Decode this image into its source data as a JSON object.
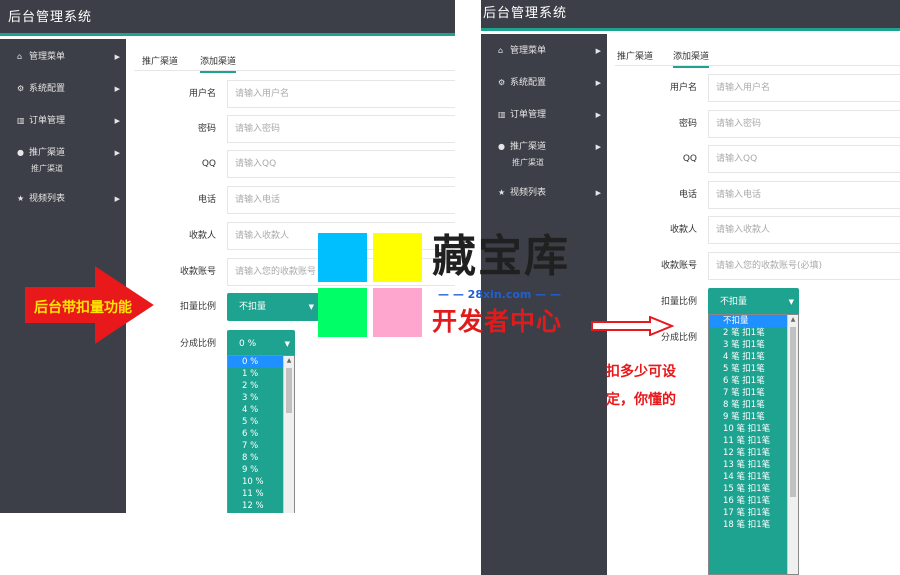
{
  "app_title": "后台管理系统",
  "sidebar": {
    "items": [
      {
        "icon": "home-icon",
        "glyph": "⌂",
        "label": "管理菜单"
      },
      {
        "icon": "gears-icon",
        "glyph": "⚙",
        "label": "系统配置"
      },
      {
        "icon": "bar-chart-icon",
        "glyph": "▥",
        "label": "订单管理"
      },
      {
        "icon": "user-icon",
        "glyph": "●",
        "label": "推广渠道",
        "sub": "推广渠道"
      },
      {
        "icon": "star-icon",
        "glyph": "★",
        "label": "视频列表"
      }
    ],
    "arrow": "▶"
  },
  "tabs": [
    "推广渠道",
    "添加渠道"
  ],
  "form": {
    "fields": [
      {
        "label": "用户名",
        "placeholder": "请输入用户名"
      },
      {
        "label": "密码",
        "placeholder": "请输入密码"
      },
      {
        "label": "QQ",
        "placeholder": "请输入QQ"
      },
      {
        "label": "电话",
        "placeholder": "请输入电话"
      },
      {
        "label": "收款人",
        "placeholder": "请输入收款人"
      },
      {
        "label": "收款账号",
        "placeholder_left": "请输入您的收款账号",
        "placeholder_right": "请输入您的收款账号(必填)"
      }
    ],
    "deduct_label": "扣量比例",
    "deduct_value": "不扣量",
    "share_label": "分成比例",
    "share_value": "0 %",
    "caret": "▼"
  },
  "share_options": [
    "0 %",
    "1 %",
    "2 %",
    "3 %",
    "4 %",
    "5 %",
    "6 %",
    "7 %",
    "8 %",
    "9 %",
    "10 %",
    "11 %",
    "12 %"
  ],
  "deduct_options": [
    "不扣量",
    "2 笔 扣1笔",
    "3 笔 扣1笔",
    "4 笔 扣1笔",
    "5 笔 扣1笔",
    "6 笔 扣1笔",
    "7 笔 扣1笔",
    "8 笔 扣1笔",
    "9 笔 扣1笔",
    "10 笔 扣1笔",
    "11 笔 扣1笔",
    "12 笔 扣1笔",
    "13 笔 扣1笔",
    "14 笔 扣1笔",
    "15 笔 扣1笔",
    "16 笔 扣1笔",
    "17 笔 扣1笔",
    "18 笔 扣1笔"
  ],
  "annotations": {
    "left_arrow_text": "后台带扣量功能",
    "right_note": "扣多少可设定，你懂的",
    "watermark_title": "藏宝库",
    "watermark_url": "— — 28xin.com — —",
    "watermark_sub": "开发者中心"
  },
  "colors": {
    "accent": "#1fa391",
    "sidebar": "#3d3f48",
    "highlight": "#1e90ff",
    "swatches": [
      "#00bfff",
      "#ffff00",
      "#00ff66",
      "#ffa6cf"
    ]
  }
}
